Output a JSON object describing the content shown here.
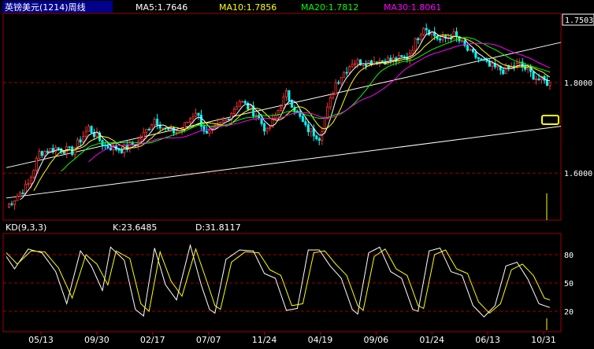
{
  "chart_data": [
    {
      "type": "candlestick",
      "title": "英镑美元(1214)周线",
      "period": "weekly",
      "ylim": [
        1.51,
        1.79
      ],
      "last_price_label": "1.7503",
      "yticks": [
        1.6,
        1.8
      ],
      "ytick_labels": [
        "1.6000",
        "1.8000"
      ],
      "colors": {
        "up": "#ff3333",
        "down": "#00ffff",
        "ma5": "#ffffff",
        "ma10": "#ffff00",
        "ma20": "#00ff00",
        "ma30": "#ff00ff"
      },
      "ma_legend": [
        {
          "name": "MA5",
          "value": "1.7646",
          "color": "#ffffff"
        },
        {
          "name": "MA10",
          "value": "1.7856",
          "color": "#ffff00"
        },
        {
          "name": "MA20",
          "value": "1.7812",
          "color": "#00ff00"
        },
        {
          "name": "MA30",
          "value": "1.8061",
          "color": "#ff00ff"
        }
      ],
      "close_anchors": [
        [
          0,
          1.525
        ],
        [
          8,
          1.575
        ],
        [
          12,
          1.645
        ],
        [
          18,
          1.655
        ],
        [
          24,
          1.648
        ],
        [
          30,
          1.7
        ],
        [
          36,
          1.66
        ],
        [
          42,
          1.652
        ],
        [
          48,
          1.668
        ],
        [
          54,
          1.72
        ],
        [
          58,
          1.695
        ],
        [
          63,
          1.69
        ],
        [
          69,
          1.737
        ],
        [
          73,
          1.683
        ],
        [
          80,
          1.718
        ],
        [
          85,
          1.76
        ],
        [
          91,
          1.73
        ],
        [
          95,
          1.69
        ],
        [
          102,
          1.775
        ],
        [
          109,
          1.7
        ],
        [
          114,
          1.68
        ],
        [
          120,
          1.8
        ],
        [
          126,
          1.845
        ],
        [
          131,
          1.845
        ],
        [
          135,
          1.848
        ],
        [
          141,
          1.85
        ],
        [
          146,
          1.855
        ],
        [
          152,
          1.925
        ],
        [
          158,
          1.893
        ],
        [
          163,
          1.905
        ],
        [
          169,
          1.865
        ],
        [
          176,
          1.835
        ],
        [
          181,
          1.827
        ],
        [
          187,
          1.84
        ],
        [
          193,
          1.81
        ],
        [
          198,
          1.797
        ]
      ]
    },
    {
      "type": "line",
      "indicator": "KD(9,3,3)",
      "ylim": [
        0,
        100
      ],
      "yticks": [
        20,
        50,
        80
      ],
      "ytick_labels": [
        "20",
        "50",
        "80"
      ],
      "series": [
        {
          "name": "K",
          "value_label": "K:23.6485",
          "color": "#ffffff",
          "anchors": [
            [
              0,
              78
            ],
            [
              3,
              65
            ],
            [
              8,
              86
            ],
            [
              13,
              82
            ],
            [
              18,
              62
            ],
            [
              22,
              28
            ],
            [
              27,
              84
            ],
            [
              31,
              68
            ],
            [
              35,
              42
            ],
            [
              38,
              88
            ],
            [
              43,
              74
            ],
            [
              47,
              22
            ],
            [
              50,
              15
            ],
            [
              54,
              87
            ],
            [
              58,
              48
            ],
            [
              62,
              32
            ],
            [
              67,
              90
            ],
            [
              71,
              48
            ],
            [
              74,
              22
            ],
            [
              76,
              18
            ],
            [
              80,
              75
            ],
            [
              85,
              85
            ],
            [
              90,
              84
            ],
            [
              94,
              60
            ],
            [
              98,
              55
            ],
            [
              102,
              21
            ],
            [
              106,
              23
            ],
            [
              110,
              85
            ],
            [
              114,
              85
            ],
            [
              118,
              68
            ],
            [
              122,
              55
            ],
            [
              126,
              22
            ],
            [
              128,
              17
            ],
            [
              132,
              82
            ],
            [
              136,
              88
            ],
            [
              140,
              62
            ],
            [
              144,
              55
            ],
            [
              148,
              22
            ],
            [
              150,
              20
            ],
            [
              154,
              84
            ],
            [
              158,
              87
            ],
            [
              162,
              62
            ],
            [
              166,
              58
            ],
            [
              170,
              26
            ],
            [
              174,
              14
            ],
            [
              178,
              26
            ],
            [
              182,
              68
            ],
            [
              186,
              72
            ],
            [
              190,
              54
            ],
            [
              194,
              28
            ],
            [
              198,
              24
            ]
          ]
        },
        {
          "name": "D",
          "value_label": "D:31.8117",
          "color": "#ffff00",
          "anchors": [
            [
              0,
              82
            ],
            [
              4,
              70
            ],
            [
              9,
              84
            ],
            [
              14,
              83
            ],
            [
              19,
              66
            ],
            [
              24,
              34
            ],
            [
              29,
              80
            ],
            [
              33,
              70
            ],
            [
              37,
              48
            ],
            [
              40,
              84
            ],
            [
              45,
              76
            ],
            [
              49,
              28
            ],
            [
              52,
              20
            ],
            [
              56,
              83
            ],
            [
              60,
              52
            ],
            [
              64,
              36
            ],
            [
              69,
              86
            ],
            [
              73,
              52
            ],
            [
              76,
              26
            ],
            [
              78,
              22
            ],
            [
              82,
              72
            ],
            [
              87,
              83
            ],
            [
              92,
              82
            ],
            [
              96,
              64
            ],
            [
              100,
              58
            ],
            [
              104,
              26
            ],
            [
              108,
              28
            ],
            [
              112,
              82
            ],
            [
              116,
              84
            ],
            [
              120,
              70
            ],
            [
              124,
              58
            ],
            [
              128,
              26
            ],
            [
              130,
              21
            ],
            [
              134,
              78
            ],
            [
              138,
              86
            ],
            [
              142,
              65
            ],
            [
              146,
              58
            ],
            [
              150,
              26
            ],
            [
              152,
              23
            ],
            [
              156,
              80
            ],
            [
              160,
              85
            ],
            [
              164,
              65
            ],
            [
              168,
              60
            ],
            [
              172,
              30
            ],
            [
              176,
              18
            ],
            [
              180,
              28
            ],
            [
              184,
              64
            ],
            [
              188,
              70
            ],
            [
              192,
              58
            ],
            [
              196,
              34
            ],
            [
              198,
              32
            ]
          ]
        }
      ]
    }
  ],
  "x_labels": [
    "05/13",
    "09/30",
    "02/17",
    "07/07",
    "11/24",
    "04/19",
    "09/06",
    "01/24",
    "06/13",
    "10/31"
  ],
  "trendlines": [
    {
      "name": "upper channel",
      "color": "#ffffff",
      "from": [
        0,
        1.612
      ],
      "to": [
        198,
        1.885
      ]
    },
    {
      "name": "lower channel",
      "color": "#ffffff",
      "from": [
        0,
        1.545
      ],
      "to": [
        198,
        1.7
      ]
    }
  ],
  "marker_rect_color": "#ffff00"
}
